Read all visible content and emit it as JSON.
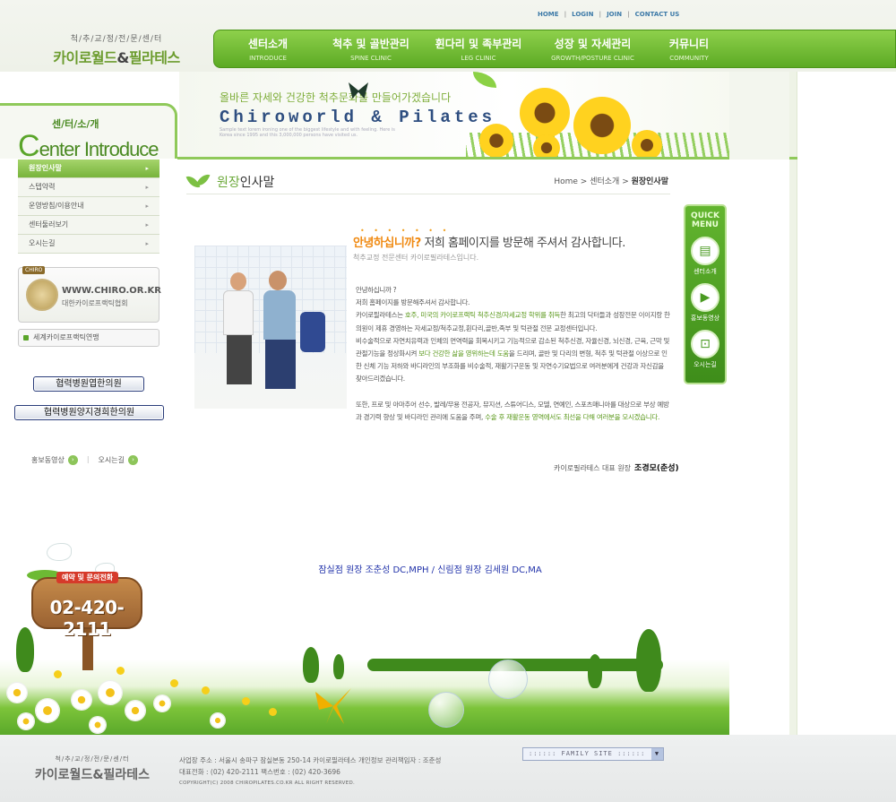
{
  "header": {
    "logo_sub": "척/추/교/정/전/문/센/터",
    "logo_main_left": "카이로월드",
    "logo_amp": "&",
    "logo_main_right": "필라테스",
    "top_links": [
      "HOME",
      "LOGIN",
      "JOIN",
      "CONTACT US"
    ],
    "nav": [
      {
        "kr": "센터소개",
        "en": "INTRODUCE"
      },
      {
        "kr": "척추 및 골반관리",
        "en": "SPINE CLINIC"
      },
      {
        "kr": "휜다리 및 족부관리",
        "en": "LEG CLINIC"
      },
      {
        "kr": "성장 및 자세관리",
        "en": "GROWTH/POSTURE CLINIC"
      },
      {
        "kr": "커뮤니티",
        "en": "COMMUNITY"
      }
    ]
  },
  "banner": {
    "slogan": "올바른 자세와 건강한 척추문화를 만들어가겠습니다",
    "title": "Chiroworld & Pilates",
    "small": "Sample text lorem ironing one of the biggest lifestyle and with feeling. Here is Korea since 1995 and this 3,000,000 persons have visited us."
  },
  "left": {
    "section_kr": "센/터/소/개",
    "section_en_big": "C",
    "section_en_rest": "enter Introduce",
    "menu": [
      {
        "label": "원장인사말",
        "active": true
      },
      {
        "label": "스텝약력",
        "active": false
      },
      {
        "label": "운영방침/이용안내",
        "active": false
      },
      {
        "label": "센터둘러보기",
        "active": false
      },
      {
        "label": "오시는길",
        "active": false
      }
    ],
    "chiro_tag": "CHIRO",
    "chiro_url": "WWW.CHIRO.OR.KR",
    "chiro_kr": "대한카이로프랙틱협회",
    "wcf": "세계카이로프랙틱연맹",
    "btn1": "협력병원엽한의원",
    "btn2": "협력병원양지경희한의원",
    "ql1": "홍보동영상",
    "ql2": "오시는길"
  },
  "content": {
    "section_title_g": "원장",
    "section_title_rest": "인사말",
    "crumb_home": "Home",
    "crumb_mid": "센터소개",
    "crumb_cur": "원장인사말",
    "dots": "• • • • • • •",
    "greet_o": "안녕하십니까?",
    "greet_rest": " 저희 홈페이지를 방문해 주셔서 감사합니다.",
    "greet_sub": "척추교정 전문센터 카이로필라테스입니다.",
    "p1_a": "안녕하십니까 ?",
    "p1_b": "저희 홈페이지를 방문해주셔서 감사합니다.",
    "p1_c1": "카이로필라테스는 ",
    "p1_c_hl": "호주, 미국의 카이로프랙틱 척추신경/자세교정 학위를 취득",
    "p1_c2": "한 최고의 닥터들과 성장전문 이이지랑 한의원이 제휴 경영하는 자세교정/척추교정,휜다리,골반,족부 및 턱관절 전문 교정센터입니다.",
    "p1_d1": "비수술적으로 자연치유력과 인체의 면역력을 회복시키고 기능적으로 감소된 척추신경, 자율신경, 뇌신경, 근육, 근막 및 관절기능을 정상화시켜 ",
    "p1_d_hl": "보다 건강한 삶을 영위하는데 도움",
    "p1_d2": "을 드리며, 골반 및 다리의 변형, 척추 및 턱관절 이상으로 인한 신체 기능 저하와 바디라인의 부조화를 비수술적, 재활기구운동 및 자연수기요법으로 여러분에게 건강과 자신감을 찾아드리겠습니다.",
    "p2_1": "또한, 프로 및 아마추어 선수, 발레/무용 전공자, 뮤지션, 스튜어디스, 모델, 연예인, 스포츠매니아를 대상으로 부상 예방과 경기력 향상 및 바디라인 관리에 도움을 주며, ",
    "p2_hl": "수술 후 재활운동 영역에서도 최선을 다해 여러분을 모시겠습니다.",
    "sig_label": "카이로필라테스 대표 원장",
    "sig_name": "조경모(춘성)",
    "blue_line": "잠실점 원장 조춘성 DC,MPH / 신림점 원장 김세원 DC,MA"
  },
  "quick": {
    "title1": "QUICK",
    "title2": "MENU",
    "items": [
      "센터소개",
      "홍보동영상",
      "오시는길"
    ]
  },
  "sign": {
    "tag": "예약 및 문의전화",
    "phone": "02-420-2111"
  },
  "footer": {
    "logo_sub": "척/추/교/정/전/문/센/터",
    "logo_main": "카이로월드&필라테스",
    "addr": "사업장 주소 : 서울시 송파구 잠실본동 250-14 카이로필라테스  개인정보 관리책임자 : 조춘성",
    "tel": "대표전화 : (02) 420-2111  팩스번호 : (02) 420-3696",
    "copy": "COPYRIGHT(C) 2008 CHIROPILATES.CO.KR ALL RIGHT RESERVED.",
    "family_site": ":::::: FAMILY SITE ::::::"
  },
  "colors": {
    "brand_green": "#5caa24",
    "accent_orange": "#f08a12",
    "link_blue": "#3d7aa8"
  }
}
